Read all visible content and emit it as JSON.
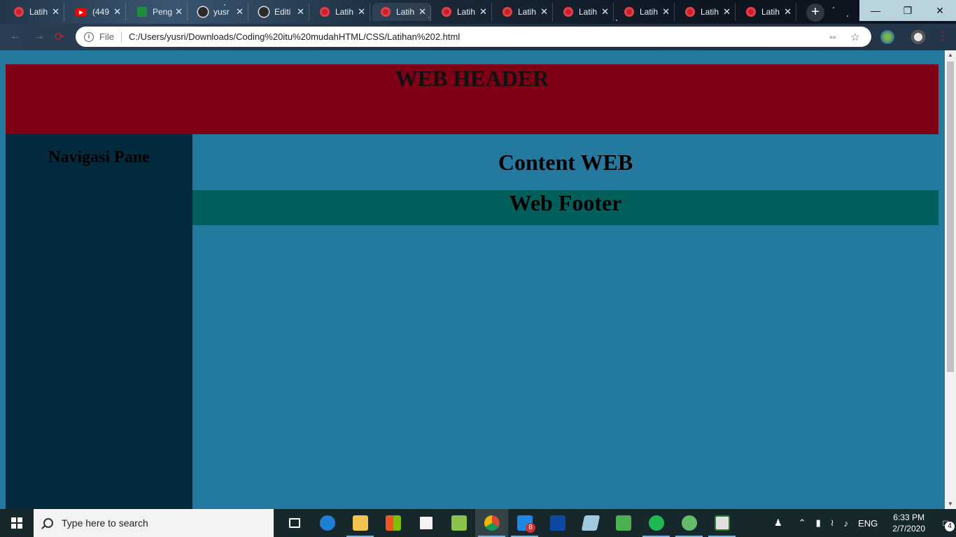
{
  "browser": {
    "tabs": [
      {
        "title": "Latih",
        "icon": "red-circle-favicon-icon"
      },
      {
        "title": "(449",
        "icon": "youtube-favicon-icon"
      },
      {
        "title": "Peng",
        "icon": "classroom-favicon-icon"
      },
      {
        "title": "yusr",
        "icon": "github-favicon-icon"
      },
      {
        "title": "Editi",
        "icon": "github-favicon-icon"
      },
      {
        "title": "Latih",
        "icon": "red-circle-favicon-icon"
      },
      {
        "title": "Latih",
        "icon": "red-circle-favicon-icon",
        "active": true
      },
      {
        "title": "Latih",
        "icon": "red-circle-favicon-icon"
      },
      {
        "title": "Latih",
        "icon": "red-circle-favicon-icon"
      },
      {
        "title": "Latih",
        "icon": "red-circle-favicon-icon"
      },
      {
        "title": "Latih",
        "icon": "red-circle-favicon-icon"
      },
      {
        "title": "Latih",
        "icon": "red-circle-favicon-icon"
      },
      {
        "title": "Latih",
        "icon": "red-circle-favicon-icon"
      }
    ],
    "omnibox": {
      "scheme_label": "File",
      "url": "C:/Users/yusri/Downloads/Coding%20itu%20mudahHTML/CSS/Latihan%202.html"
    }
  },
  "page": {
    "header": "WEB HEADER",
    "nav_pane": "Navigasi Pane",
    "content": "Content WEB",
    "footer": "Web Footer"
  },
  "taskbar": {
    "search_placeholder": "Type here to search",
    "whatsapp_badge": "8",
    "language": "ENG",
    "time": "6:33 PM",
    "date": "2/7/2020",
    "notification_count": "4"
  }
}
